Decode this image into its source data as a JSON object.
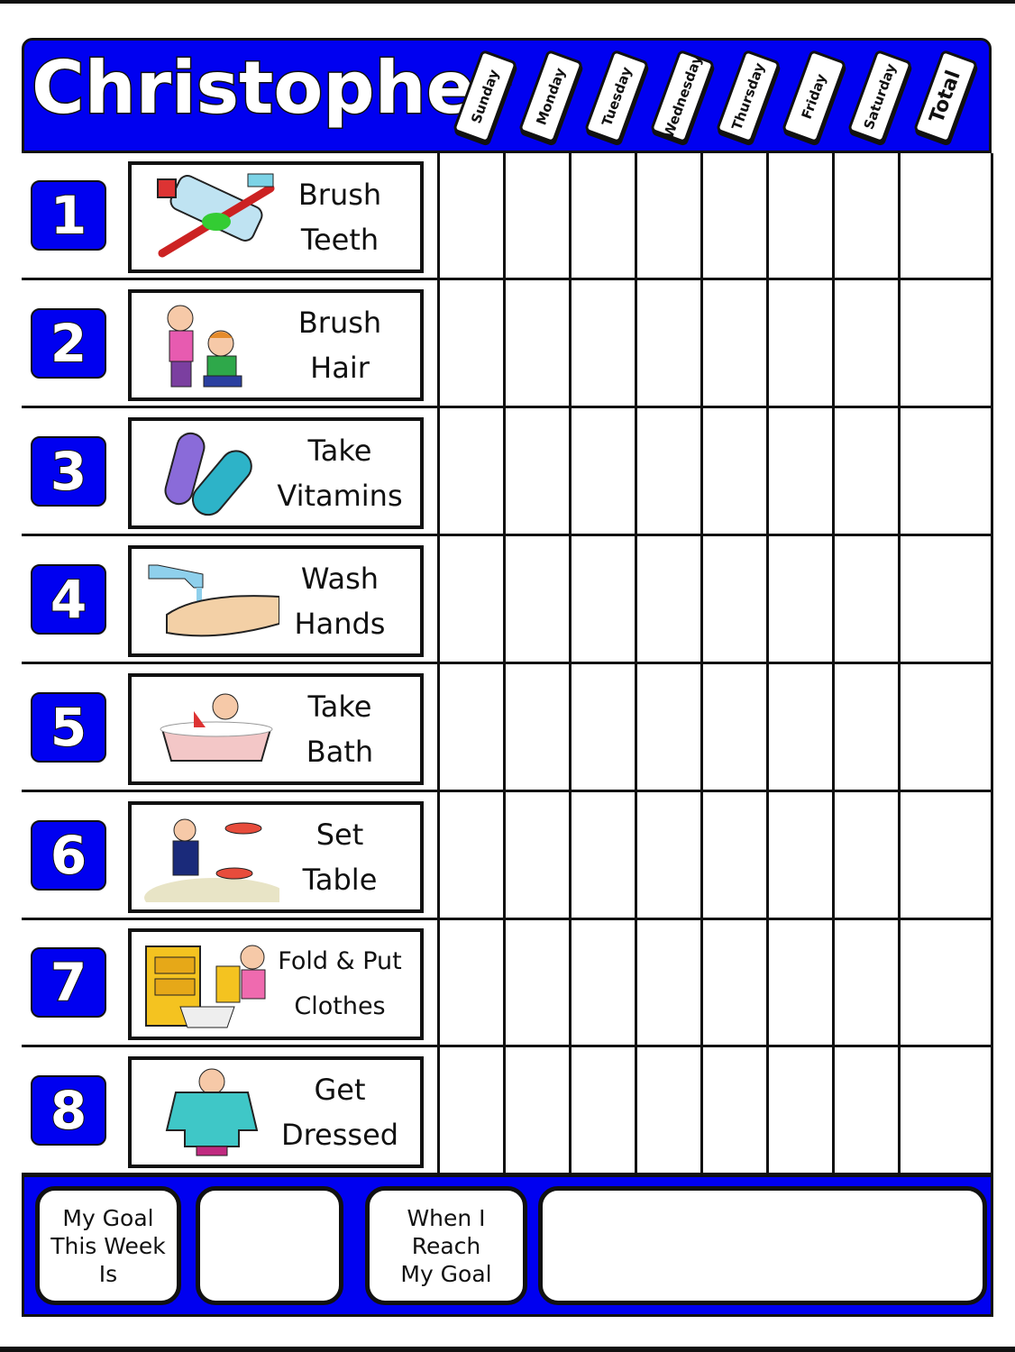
{
  "chart": {
    "name": "Christopher",
    "columns": [
      "Sunday",
      "Monday",
      "Tuesday",
      "Wednesday",
      "Thursday",
      "Friday",
      "Saturday",
      "Total"
    ],
    "tasks": [
      {
        "number": "1",
        "line1": "Brush",
        "line2": "Teeth",
        "icon": "toothbrush-icon"
      },
      {
        "number": "2",
        "line1": "Brush",
        "line2": "Hair",
        "icon": "hairbrush-icon"
      },
      {
        "number": "3",
        "line1": "Take",
        "line2": "Vitamins",
        "icon": "pills-icon"
      },
      {
        "number": "4",
        "line1": "Wash",
        "line2": "Hands",
        "icon": "handwash-icon"
      },
      {
        "number": "5",
        "line1": "Take",
        "line2": "Bath",
        "icon": "bathtub-icon"
      },
      {
        "number": "6",
        "line1": "Set",
        "line2": "Table",
        "icon": "table-setting-icon"
      },
      {
        "number": "7",
        "line1": "Fold & Put",
        "line2": "Clothes",
        "icon": "laundry-icon"
      },
      {
        "number": "8",
        "line1": "Get",
        "line2": "Dressed",
        "icon": "sweater-icon"
      }
    ]
  },
  "footer": {
    "goal_label": "My Goal\nThis Week\nIs",
    "goal_value": "",
    "reward_label": "When I\nReach\nMy Goal",
    "reward_value": ""
  },
  "colors": {
    "accent": "#0000f0",
    "ink": "#111111"
  }
}
